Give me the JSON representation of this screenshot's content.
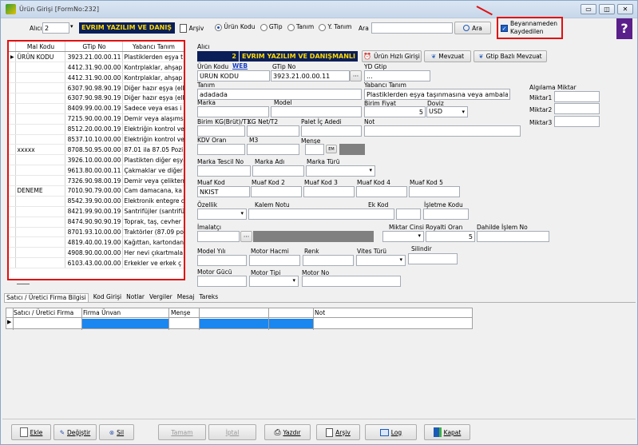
{
  "window": {
    "title": "Ürün Girişi [FormNo:232]"
  },
  "topbar": {
    "alici_label": "Alıcı",
    "alici_value": "2",
    "company_name": "EVRIM YAZILIM VE DANIŞ",
    "arsiv_label": "Arşiv",
    "radio_options": [
      "Ürün Kodu",
      "GTip",
      "Tanım",
      "Y. Tanım"
    ],
    "radio_selected": "Ürün Kodu",
    "ara_label": "Ara",
    "ara_value": "",
    "ara_button": "Ara",
    "beyanname_line1": "Beyannameden",
    "beyanname_line2": "Kaydedilen",
    "beyanname_checked": true,
    "help_label": "?"
  },
  "grid": {
    "columns": [
      "Mal Kodu",
      "GTip No",
      "Yabancı Tanım"
    ],
    "rows": [
      [
        "ÜRÜN KODU",
        "3923.21.00.00.11",
        "Plastiklerden eşya t"
      ],
      [
        "",
        "4412.31.90.00.00",
        "Kontrplaklar, ahşap"
      ],
      [
        "",
        "4412.31.90.00.00",
        "Kontrplaklar, ahşap"
      ],
      [
        "",
        "6307.90.98.90.19",
        "Diğer hazır eşya (elb"
      ],
      [
        "",
        "6307.90.98.90.19",
        "Diğer hazır eşya (elb"
      ],
      [
        "",
        "8409.99.00.00.19",
        "Sadece veya esas i"
      ],
      [
        "",
        "7215.90.00.00.19",
        "Demir veya alaşımsı"
      ],
      [
        "",
        "8512.20.00.00.19",
        "Elektriğin kontrol ve"
      ],
      [
        "",
        "8537.10.10.00.00",
        "Elektriğin kontrol ve"
      ],
      [
        "xxxxx",
        "8708.50.95.00.00",
        "87.01 ila 87.05 Pozi"
      ],
      [
        "",
        "3926.10.00.00.00",
        "Plastikten diğer eşya"
      ],
      [
        "",
        "9613.80.00.00.11",
        "Çakmaklar ve diğer"
      ],
      [
        "",
        "7326.90.98.00.19",
        "Demir veya çelikten"
      ],
      [
        "DENEME",
        "7010.90.79.00.00",
        "Cam damacana, ka"
      ],
      [
        "",
        "8542.39.90.00.00",
        "Elektronik entegre d"
      ],
      [
        "",
        "8421.99.90.00.19",
        "Santrifüjler (santrifüj"
      ],
      [
        "",
        "8474.90.90.90.19",
        "Toprak, taş, cevher"
      ],
      [
        "",
        "8701.93.10.00.00",
        "Traktörler (87.09 po"
      ],
      [
        "",
        "4819.40.00.19.00",
        "Kağıttan, kartondan"
      ],
      [
        "",
        "4908.90.00.00.00",
        "Her nevi çıkartmala"
      ],
      [
        "",
        "6103.43.00.00.00",
        "Erkekler ve erkek ç"
      ]
    ]
  },
  "form": {
    "alici_label": "Alıcı",
    "alici_num": "2",
    "alici_name": "EVRIM YAZILIM VE DANIŞMANLI",
    "urun_hizli_girisi": "Ürün Hızlı Girişi",
    "mevzuat": "Mevzuat",
    "gtip_bazli_mevzuat": "Gtip Bazlı Mevzuat",
    "urun_kodu_label": "Ürün Kodu",
    "web_link": "WEB",
    "gtip_no_label": "GTip No",
    "yd_gtip_label": "YD Gtip",
    "urun_kodu_value": "ÜRÜN KODU",
    "gtip_no_value": "3923.21.00.00.11",
    "yd_gtip_value": "...",
    "tanim_label": "Tanım",
    "tanim_value": "adadada",
    "yabanci_tanim_label": "Yabancı Tanım",
    "yabanci_tanim_value": "Plastiklerden eşya taşınmasına veya ambalajlanmasına",
    "algilama_miktar_label": "Algılama Miktar",
    "miktar1_label": "Miktar1",
    "miktar2_label": "Miktar2",
    "miktar3_label": "Miktar3",
    "marka_label": "Marka",
    "model_label": "Model",
    "birim_fiyat_label": "Birim Fiyat",
    "birim_fiyat_value": "5",
    "doviz_label": "Doviz",
    "doviz_value": "USD",
    "birim_kg_label": "Birim KG(Brüt)/T1",
    "kg_net_label": "KG Net/T2",
    "palet_label": "Palet İç Adedi",
    "not_label": "Not",
    "kdv_label": "KDV Oran",
    "m3_label": "M3",
    "mense_label": "Menşe",
    "marka_tescil_label": "Marka Tescil No",
    "marka_adi_label": "Marka Adı",
    "marka_turu_label": "Marka Türü",
    "muaf1_label": "Muaf Kod",
    "muaf1_value": "NKIST",
    "muaf2_label": "Muaf Kod 2",
    "muaf3_label": "Muaf Kod 3",
    "muaf4_label": "Muaf Kod 4",
    "muaf5_label": "Muaf Kod 5",
    "ozellik_label": "Özellik",
    "kalem_notu_label": "Kalem Notu",
    "ek_kod_label": "Ek Kod",
    "isletme_kodu_label": "İşletme Kodu",
    "imalatci_label": "İmalatçı",
    "miktar_cinsi_label": "Miktar Cinsi",
    "royalti_label": "Royalti Oran",
    "royalti_value": "5",
    "dahilde_label": "Dahilde İşlem No",
    "model_yili_label": "Model Yılı",
    "motor_hacmi_label": "Motor Hacmi",
    "renk_label": "Renk",
    "vites_label": "Vites Türü",
    "silindir_label": "Silindir",
    "motor_gucu_label": "Motor Gücü",
    "motor_tipi_label": "Motor Tipi",
    "motor_no_label": "Motor No"
  },
  "tabs": [
    "Satıcı / Üretici Firma Bilgisi",
    "Kod Girişi",
    "Notlar",
    "Vergiler",
    "Mesaj",
    "Tareks"
  ],
  "subgrid": {
    "columns": [
      "Satıcı / Üretici Firma",
      "Firma Ünvan",
      "Menşe",
      "",
      "",
      "Not"
    ]
  },
  "bottom": {
    "ekle": "Ekle",
    "degistir": "Değiştir",
    "sil": "Sil",
    "tamam": "Tamam",
    "iptal": "İptal",
    "yazdir": "Yazdır",
    "arsiv": "Arşiv",
    "log": "Log",
    "kapat": "Kapat"
  },
  "colors": {
    "accent_yellow": "#ffd800",
    "dark_navy": "#0a1e58",
    "highlight_red": "#e01010",
    "selection_blue": "#1a86f0"
  }
}
